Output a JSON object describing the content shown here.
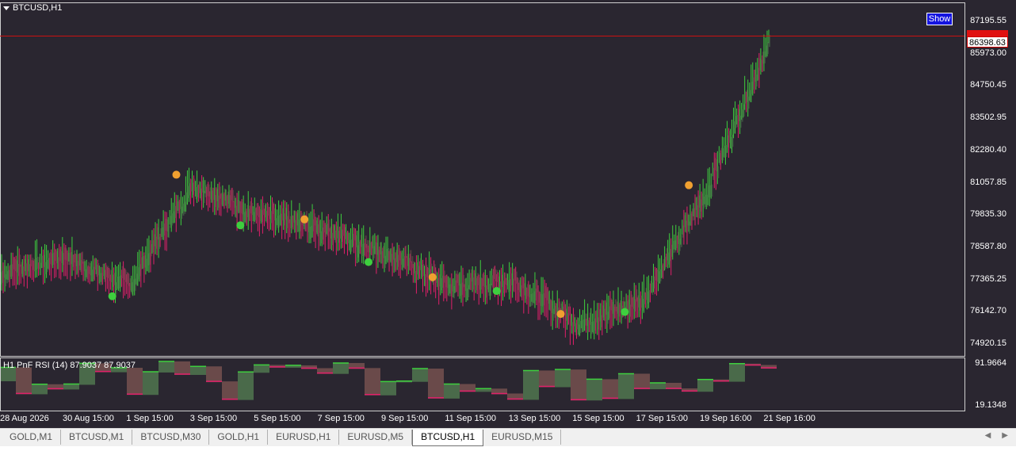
{
  "chart": {
    "symbol": "BTCUSD,H1",
    "show_button": "Show",
    "current_price": "86398.63",
    "price_axis": [
      "87195.55",
      "85973.00",
      "84750.45",
      "83502.95",
      "82280.40",
      "81057.85",
      "79835.30",
      "78587.80",
      "77365.25",
      "76142.70",
      "74920.15"
    ],
    "indicator_label": "H1 PnF RSI (14) 87.9037 87.9037",
    "indicator_axis": [
      "91.9664",
      "19.1348"
    ],
    "time_axis": [
      "28 Aug 2026",
      "30 Aug 15:00",
      "1 Sep 15:00",
      "3 Sep 15:00",
      "5 Sep 15:00",
      "7 Sep 15:00",
      "9 Sep 15:00",
      "11 Sep 15:00",
      "13 Sep 15:00",
      "15 Sep 15:00",
      "17 Sep 15:00",
      "19 Sep 16:00",
      "21 Sep 16:00"
    ],
    "colors": {
      "background": "#2a2630",
      "bull": "#3ecf3e",
      "bear": "#e0206a",
      "cloud_bull": "#4a6a4a",
      "cloud_bear": "#6a4a4a",
      "price_line": "#cc1010"
    }
  },
  "tabs": [
    {
      "label": "GOLD,M1",
      "active": false
    },
    {
      "label": "BTCUSD,M1",
      "active": false
    },
    {
      "label": "BTCUSD,M30",
      "active": false
    },
    {
      "label": "GOLD,H1",
      "active": false
    },
    {
      "label": "EURUSD,H1",
      "active": false
    },
    {
      "label": "EURUSD,M5",
      "active": false
    },
    {
      "label": "BTCUSD,H1",
      "active": true
    },
    {
      "label": "EURUSD,M15",
      "active": false
    }
  ],
  "nav": {
    "left": "◀",
    "right": "▶"
  },
  "chart_data": {
    "type": "line",
    "x": [
      "28 Aug 2026",
      "30 Aug 15:00",
      "1 Sep 15:00",
      "3 Sep 15:00",
      "5 Sep 15:00",
      "7 Sep 15:00",
      "9 Sep 15:00",
      "11 Sep 15:00",
      "13 Sep 15:00",
      "15 Sep 15:00",
      "17 Sep 15:00",
      "19 Sep 16:00",
      "21 Sep 16:00"
    ],
    "series": [
      {
        "values": [
          77600,
          78200,
          77100,
          81000,
          79800,
          79300,
          78400,
          77100,
          77300,
          75700,
          76500,
          80600,
          86400
        ]
      }
    ],
    "ylim": [
      74920.15,
      87195.55
    ]
  }
}
